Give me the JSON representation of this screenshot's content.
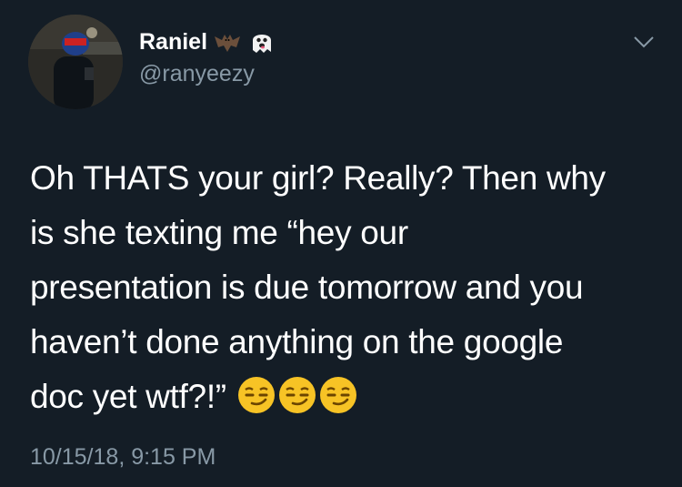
{
  "user": {
    "display_name": "Raniel",
    "handle": "@ranyeezy",
    "name_emojis": [
      "bat-emoji",
      "ghost-emoji"
    ]
  },
  "tweet": {
    "lines": [
      "Oh THATS your girl? Really? Then why",
      "is she texting me “hey our",
      "presentation is due tomorrow and you",
      "haven’t done anything on the google",
      "doc yet wtf?!”"
    ],
    "trailing_emojis": [
      "smirk-emoji",
      "smirk-emoji",
      "smirk-emoji"
    ],
    "timestamp": "10/15/18, 9:15 PM"
  },
  "icons": {
    "menu": "chevron-down-icon"
  },
  "colors": {
    "background": "#141d26",
    "text_primary": "#ffffff",
    "text_secondary": "#8899a6",
    "emoji_yellow": "#f7c325"
  }
}
